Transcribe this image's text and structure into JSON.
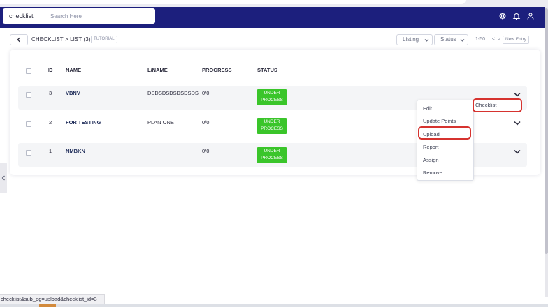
{
  "header": {
    "app_title": "checklist",
    "search_placeholder": "Search Here",
    "icons": [
      "settings-gear-icon",
      "bell-icon",
      "user-icon"
    ],
    "nav_color": "#1c1f7d"
  },
  "breadcrumb": {
    "text": "CHECKLIST > LIST (3)",
    "tutorial_label": "TUTORIAL"
  },
  "toolbar": {
    "listing_label": "Listing",
    "status_label": "Status",
    "pager_text": "1-50",
    "pager_arrows": "< >",
    "new_entry_label": "New Entry"
  },
  "table": {
    "headers": {
      "id": "ID",
      "name": "NAME",
      "lname": "L/NAME",
      "progress": "PROGRESS",
      "status": "STATUS"
    },
    "rows": [
      {
        "id": "3",
        "name": "VBNV",
        "lname": "DSDSDSDSDSDSDS",
        "progress": "0/0",
        "status_line1": "UNDER",
        "status_line2": "PROCESS"
      },
      {
        "id": "2",
        "name": "FOR TESTING",
        "lname": "PLAN ONE",
        "progress": "0/0",
        "status_line1": "UNDER",
        "status_line2": "PROCESS"
      },
      {
        "id": "1",
        "name": "NMBKN",
        "lname": "",
        "progress": "0/0",
        "status_line1": "UNDER",
        "status_line2": "PROCESS"
      }
    ],
    "status_color": "#3ac52a"
  },
  "action_menu": {
    "items": [
      "Edit",
      "Update Points",
      "Upload",
      "Report",
      "Assign",
      "Remove"
    ],
    "flyout_label": "Checklist",
    "highlight_color": "#d6332f"
  },
  "status_bar": {
    "url": "checklist&sub_pg=upload&checklist_id=3"
  }
}
